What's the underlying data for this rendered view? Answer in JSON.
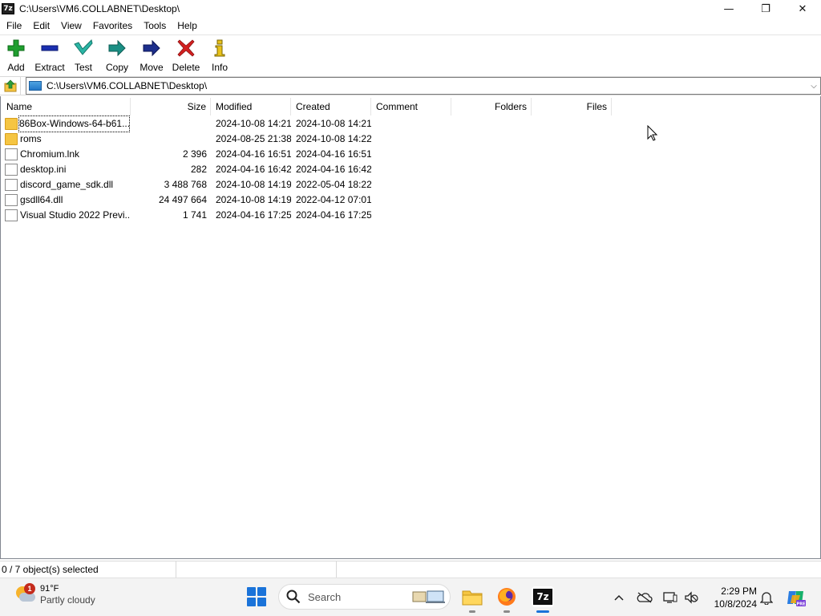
{
  "window": {
    "app_icon_text": "7z",
    "title": "C:\\Users\\VM6.COLLABNET\\Desktop\\",
    "minimize": "—",
    "maximize": "❐",
    "close": "✕"
  },
  "menu": [
    "File",
    "Edit",
    "View",
    "Favorites",
    "Tools",
    "Help"
  ],
  "toolbar": {
    "add": "Add",
    "extract": "Extract",
    "test": "Test",
    "copy": "Copy",
    "move": "Move",
    "delete": "Delete",
    "info": "Info"
  },
  "address": {
    "path": "C:\\Users\\VM6.COLLABNET\\Desktop\\",
    "dropdown": "⌵"
  },
  "columns": {
    "name": "Name",
    "size": "Size",
    "modified": "Modified",
    "created": "Created",
    "comment": "Comment",
    "folders": "Folders",
    "files": "Files"
  },
  "rows": [
    {
      "name": "86Box-Windows-64-b61...",
      "size": "",
      "modified": "2024-10-08 14:21",
      "created": "2024-10-08 14:21",
      "type": "folder"
    },
    {
      "name": "roms",
      "size": "",
      "modified": "2024-08-25 21:38",
      "created": "2024-10-08 14:22",
      "type": "folder"
    },
    {
      "name": "Chromium.lnk",
      "size": "2 396",
      "modified": "2024-04-16 16:51",
      "created": "2024-04-16 16:51",
      "type": "file"
    },
    {
      "name": "desktop.ini",
      "size": "282",
      "modified": "2024-04-16 16:42",
      "created": "2024-04-16 16:42",
      "type": "file"
    },
    {
      "name": "discord_game_sdk.dll",
      "size": "3 488 768",
      "modified": "2024-10-08 14:19",
      "created": "2022-05-04 18:22",
      "type": "file"
    },
    {
      "name": "gsdll64.dll",
      "size": "24 497 664",
      "modified": "2024-10-08 14:19",
      "created": "2022-04-12 07:01",
      "type": "file"
    },
    {
      "name": "Visual Studio 2022 Previ...",
      "size": "1 741",
      "modified": "2024-04-16 17:25",
      "created": "2024-04-16 17:25",
      "type": "file"
    }
  ],
  "status": {
    "selection": "0 / 7 object(s) selected"
  },
  "taskbar": {
    "weather_badge": "1",
    "temperature": "91°F",
    "condition": "Partly cloudy",
    "search_placeholder": "Search",
    "tray_chevron": "^",
    "time": "2:29 PM",
    "date": "10/8/2024",
    "sevenzip_icon_text": "7z"
  },
  "colors": {
    "add_icon": "#1e9e2e",
    "extract_icon": "#1a2fb0",
    "test_icon": "#2bb5a5",
    "copy_icon": "#1a8f84",
    "move_icon": "#1d2f8c",
    "delete_icon": "#d22020",
    "info_icon": "#c6a000"
  }
}
